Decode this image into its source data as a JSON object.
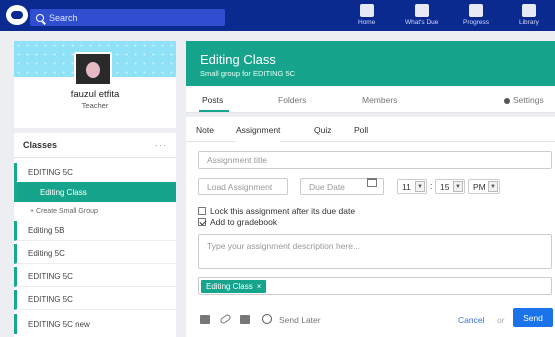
{
  "topbar": {
    "search_placeholder": "Search",
    "nav": [
      {
        "label": "Home",
        "icon": "home-icon"
      },
      {
        "label": "What's Due",
        "icon": "inbox-icon"
      },
      {
        "label": "Progress",
        "icon": "pulse-icon"
      },
      {
        "label": "Library",
        "icon": "library-icon"
      }
    ]
  },
  "profile": {
    "name": "fauzul etfita",
    "role": "Teacher"
  },
  "classes": {
    "title": "Classes",
    "menu": "···",
    "items": [
      {
        "label": "EDITING 5C"
      },
      {
        "label": "Editing Class",
        "selected": true
      },
      {
        "label": "+ Create Small Group"
      },
      {
        "label": "Editing 5B"
      },
      {
        "label": "Editing 5C"
      },
      {
        "label": "EDITING 5C"
      },
      {
        "label": "EDITING 5C"
      },
      {
        "label": "EDITING 5C new"
      }
    ]
  },
  "group": {
    "title": "Editing Class",
    "subtitle": "Small group for EDITING 5C",
    "tabs": [
      "Posts",
      "Folders",
      "Members"
    ],
    "settings_label": "Settings"
  },
  "composer": {
    "tabs": [
      "Note",
      "Assignment",
      "Quiz",
      "Poll"
    ],
    "active_tab": "Assignment",
    "title_placeholder": "Assignment title",
    "load_label": "Load Assignment",
    "due_placeholder": "Due Date",
    "hour": "11",
    "minute": "15",
    "ampm": "PM",
    "lock_label": "Lock this assignment after its due date",
    "gradebook_label": "Add to gradebook",
    "lock_checked": false,
    "gradebook_checked": true,
    "desc_placeholder": "Type your assignment description here...",
    "recipient": "Editing Class",
    "recipient_remove": "×",
    "send_later": "Send Later",
    "cancel": "Cancel",
    "or": "or",
    "send": "Send"
  },
  "colors": {
    "nav": "#0b2a8f",
    "accent": "#16a58c",
    "send": "#1a73e8"
  }
}
